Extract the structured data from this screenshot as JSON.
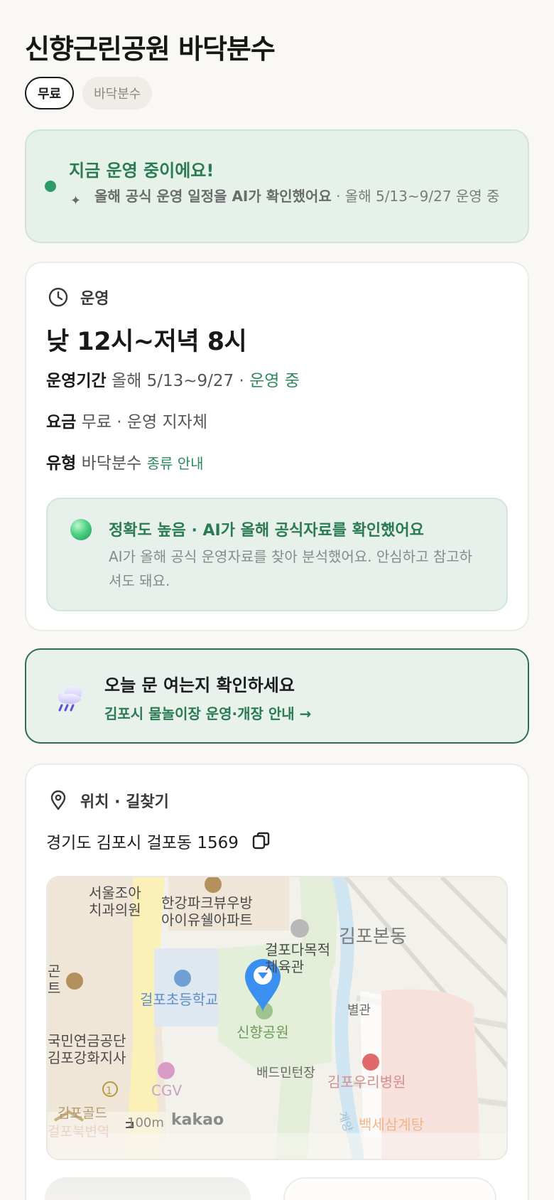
{
  "title": "신향근린공원 바닥분수",
  "chips": {
    "fee": "무료",
    "type": "바닥분수"
  },
  "status": {
    "headline": "지금 운영 중이에요!",
    "ai_note": "올해 공식 운영 일정을 AI가 확인했어요",
    "detail": " · 올해 5/13~9/27 운영 중"
  },
  "operation": {
    "section_label": "운영",
    "hours": "낮 12시~저녁 8시",
    "period_label": "운영기간",
    "period_value": "올해 5/13~9/27 · ",
    "period_status": "운영 중",
    "fee_label": "요금",
    "fee_value": "무료 · 운영 지자체",
    "type_label": "유형",
    "type_value": "바닥분수 ",
    "type_link": "종류 안내",
    "accuracy": {
      "headline": "정확도 높음 · AI가 올해 공식자료를 확인했어요",
      "body": "AI가 올해 공식 운영자료를 찾아 분석했어요. 안심하고 참고하셔도 돼요."
    }
  },
  "check": {
    "headline": "오늘 문 여는지 확인하세요",
    "link": "김포시 물놀이장 운영·개장 안내 →"
  },
  "location": {
    "section_label": "위치 · 길찾기",
    "address": "경기도 김포시 걸포동 1569",
    "map_labels": {
      "dental": "서울조아\n치과의원",
      "apt": "한강파크뷰우방\n아이유쉘아파트",
      "gym": "걸포다목적\n체육관",
      "district": "김포본동",
      "school": "걸포초등학교",
      "park": "신향공원",
      "annex": "별관",
      "pension": "국민연금공단\n김포강화지사",
      "badminton": "배드민턴장",
      "hospital": "김포우리병원",
      "cgv": "CGV",
      "gold": "김포골드",
      "station": "걸포북변역",
      "restaurant": "백세삼계탕",
      "left_edge": "곤\n트",
      "stream": "계양",
      "scale": "100m",
      "brand": "kakao",
      "badge_1": "1"
    }
  },
  "colors": {
    "accent_green": "#2a7a52",
    "status_bg": "#e6f1ea",
    "marker_blue": "#3b8ff0"
  }
}
